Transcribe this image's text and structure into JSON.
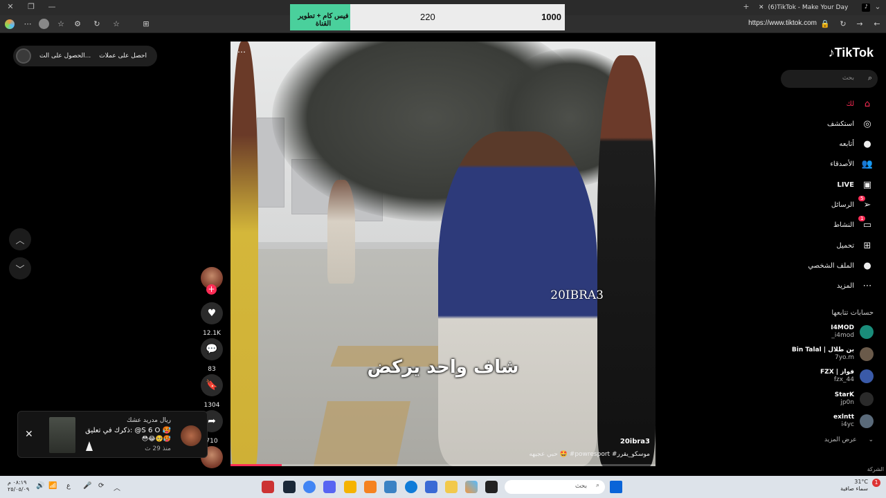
{
  "browser": {
    "tab_title": "(6)TikTok - Make Your Day",
    "url": "https://www.tiktok.com"
  },
  "overlay_widget": {
    "label": "فيس كام + تطوير القناة",
    "current": "220",
    "goal": "1000",
    "progress_fraction": 0.22
  },
  "promo": {
    "item1": "احصل على عملات",
    "item2": "الحصول على الت..."
  },
  "video": {
    "caption": "شاف واحد يركض",
    "watermark": "20IBRA3",
    "author": "20ibra3",
    "description": "حبي عجيهه 🤩 #powresport #موسكو_يقرر",
    "progress_fraction": 0.12
  },
  "actions": {
    "likes": "12.1K",
    "comments": "83",
    "saves": "1304",
    "shares": "710"
  },
  "notification": {
    "title": "ريال مدريد عشك",
    "message": "ذكرك في تعليق: @S 6 O 🥵",
    "emojis": "😳😂🥺🥵",
    "time": "منذ 29 ث"
  },
  "sidebar": {
    "logo": "TikTok",
    "search_placeholder": "بحث",
    "nav": [
      {
        "label": "لك",
        "icon": "home-icon",
        "active": true
      },
      {
        "label": "استكشف",
        "icon": "compass-icon"
      },
      {
        "label": "أتابعه",
        "icon": "following-avatar-icon"
      },
      {
        "label": "الأصدقاء",
        "icon": "friends-icon"
      },
      {
        "label": "LIVE",
        "icon": "live-icon"
      },
      {
        "label": "الرسائل",
        "icon": "messages-icon",
        "badge": "5"
      },
      {
        "label": "النشاط",
        "icon": "activity-icon",
        "badge": "1"
      },
      {
        "label": "تحميل",
        "icon": "upload-icon"
      },
      {
        "label": "الملف الشخصي",
        "icon": "profile-avatar-icon"
      },
      {
        "label": "المزيد",
        "icon": "more-icon"
      }
    ],
    "following_title": "حسابات تتابعها",
    "accounts": [
      {
        "name": "I4MOD",
        "handle": "_i4mod"
      },
      {
        "name": "Bin Talal | بن طلال",
        "handle": "7yo.m"
      },
      {
        "name": "FZX | فواز",
        "handle": "fzx_44"
      },
      {
        "name": "StarK",
        "handle": "jp0n"
      },
      {
        "name": "exlntt",
        "handle": "i4yc"
      }
    ],
    "show_more": "عرض المزيد",
    "company": "الشركة"
  },
  "taskbar": {
    "search": "بحث",
    "time": "٠٨:١٩ م",
    "date": "٢٥/٠٥/٠٩",
    "temperature": "31°C",
    "weather_text": "سماء صافية",
    "notification_count": "1"
  }
}
